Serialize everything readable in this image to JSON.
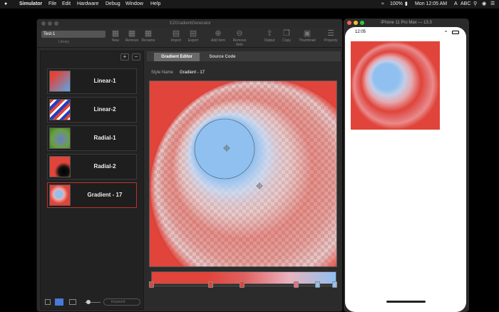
{
  "menubar": {
    "apple": "",
    "app": "Simulator",
    "items": [
      "File",
      "Edit",
      "Hardware",
      "Debug",
      "Window",
      "Help"
    ],
    "battery": "100%",
    "clock": "Mon 12:05 AM",
    "input": "ABC"
  },
  "window": {
    "title": "EZGradientGenerator",
    "document_name": "Test-1",
    "library_label": "Library",
    "toolbar": [
      {
        "label": "New",
        "icon": "new-icon"
      },
      {
        "label": "Remove",
        "icon": "remove-icon"
      },
      {
        "label": "Rename",
        "icon": "rename-icon"
      },
      {
        "label": "Import",
        "icon": "import-icon"
      },
      {
        "label": "Export",
        "icon": "export-icon"
      },
      {
        "label": "Add Item",
        "icon": "plus-circle-icon"
      },
      {
        "label": "Remove Item",
        "icon": "minus-circle-icon"
      },
      {
        "label": "Output",
        "icon": "output-icon"
      },
      {
        "label": "Copy",
        "icon": "copy-icon"
      },
      {
        "label": "Thumbnail",
        "icon": "image-icon"
      },
      {
        "label": "Property",
        "icon": "list-icon"
      }
    ]
  },
  "sidebar": {
    "add": "+",
    "remove": "−",
    "items": [
      {
        "label": "Linear-1"
      },
      {
        "label": "Linear-2"
      },
      {
        "label": "Radial-1"
      },
      {
        "label": "Radial-2"
      },
      {
        "label": "Gradient - 17"
      }
    ],
    "keyword_placeholder": "Keyword"
  },
  "editor": {
    "tabs": [
      "Gradient Editor",
      "Source Code"
    ],
    "style_name_label": "Style Name",
    "style_name_value": "Gradient - 17",
    "colors": {
      "red": "#e0443a",
      "blue": "#8fc0f0",
      "selection": "#c0302a"
    }
  },
  "phone": {
    "title": "iPhone 11 Pro Max — 13.3",
    "time": "12:05"
  }
}
